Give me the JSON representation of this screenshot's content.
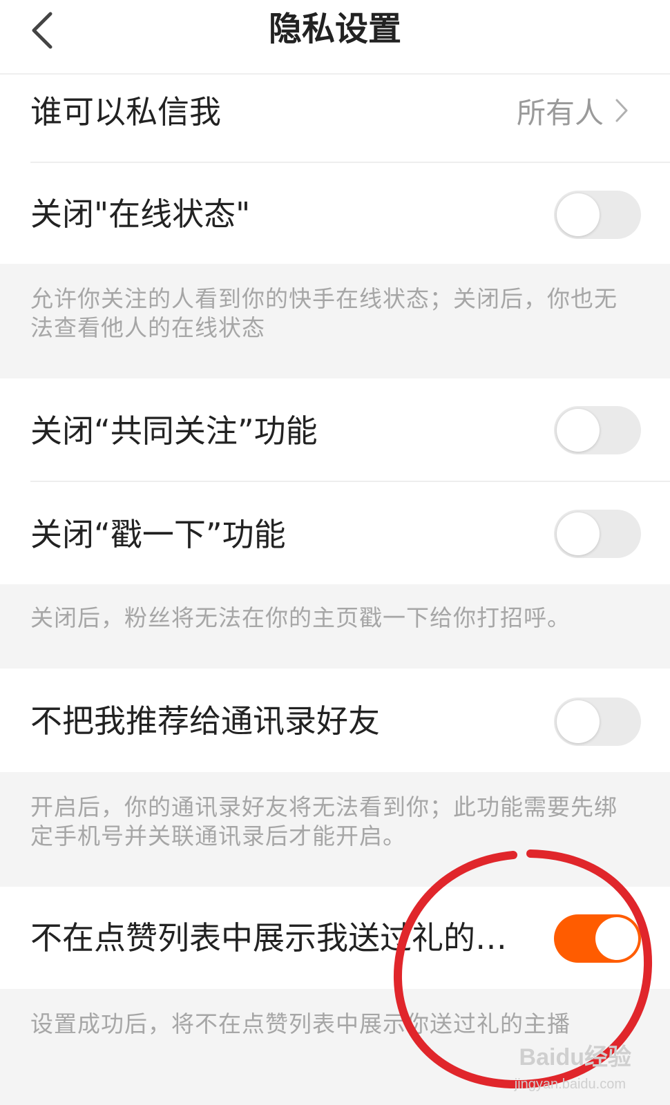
{
  "header": {
    "title": "隐私设置"
  },
  "rows": {
    "who_can_message": {
      "label": "谁可以私信我",
      "value": "所有人"
    },
    "online_status": {
      "label": "关闭\"在线状态\"",
      "on": false
    },
    "online_status_desc": "允许你关注的人看到你的快手在线状态；关闭后，你也无法查看他人的在线状态",
    "mutual_follow": {
      "label": "关闭“共同关注”功能",
      "on": false
    },
    "poke": {
      "label": "关闭“戳一下”功能",
      "on": false
    },
    "poke_desc": "关闭后，粉丝将无法在你的主页戳一下给你打招呼。",
    "contacts": {
      "label": "不把我推荐给通讯录好友",
      "on": false
    },
    "contacts_desc": "开启后，你的通讯录好友将无法看到你；此功能需要先绑定手机号并关联通讯录后才能开启。",
    "gift_list": {
      "label": "不在点赞列表中展示我送过礼的…",
      "on": true
    },
    "gift_list_desc": "设置成功后，将不在点赞列表中展示你送过礼的主播"
  },
  "watermark": {
    "brand": "Baidu经验",
    "url": "jingyan.baidu.com"
  },
  "colors": {
    "accent": "#ff5c00",
    "switch_off": "#eaeaea",
    "annotation_circle": "#e0262b",
    "desc_background": "#f4f4f4"
  }
}
